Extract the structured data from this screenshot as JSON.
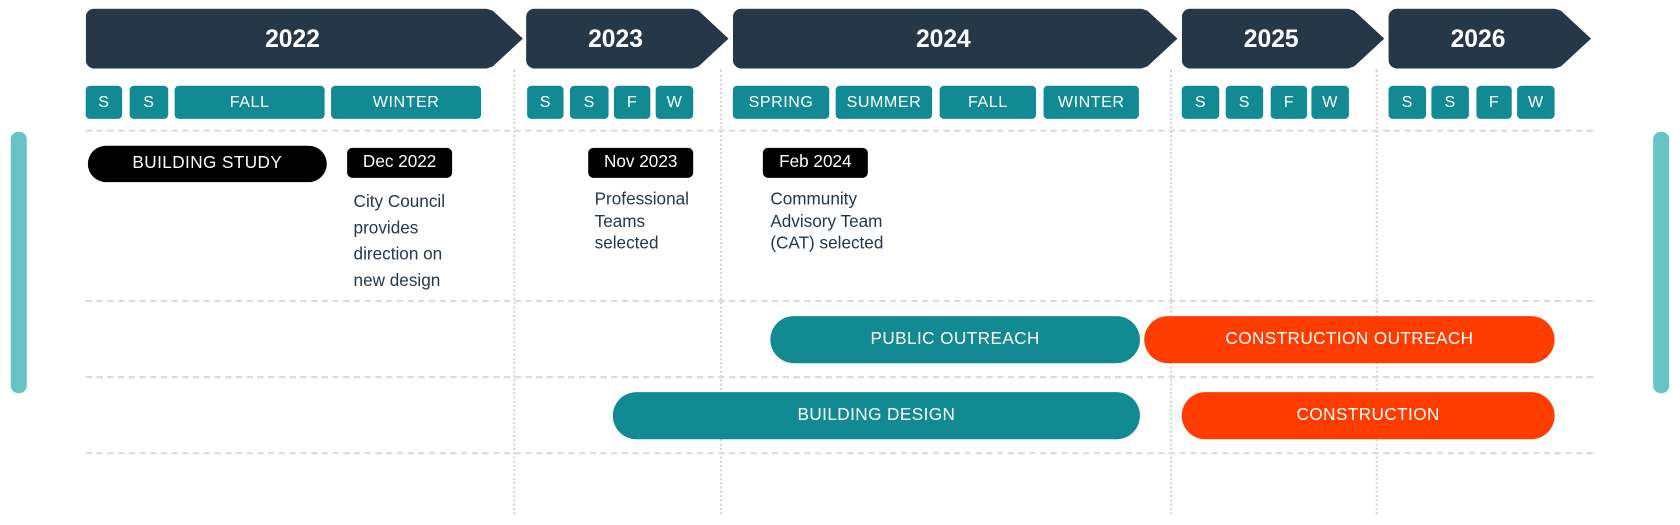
{
  "colors": {
    "year_banner": "#263747",
    "season": "#128a94",
    "phase_teal": "#128a94",
    "phase_orange": "#ff3d00",
    "scroll_bar": "#66c5c4",
    "milestone": "#000000"
  },
  "years": [
    "2022",
    "2023",
    "2024",
    "2025",
    "2026"
  ],
  "seasons": {
    "y2022": [
      "S",
      "S",
      "FALL",
      "WINTER"
    ],
    "y2023": [
      "S",
      "S",
      "F",
      "W"
    ],
    "y2024": [
      "SPRING",
      "SUMMER",
      "FALL",
      "WINTER"
    ],
    "y2025": [
      "S",
      "S",
      "F",
      "W"
    ],
    "y2026": [
      "S",
      "S",
      "F",
      "W"
    ]
  },
  "milestones": {
    "building_study": "BUILDING STUDY",
    "items": [
      {
        "date": "Dec 2022",
        "text": "City Council\nprovides\ndirection on\nnew design"
      },
      {
        "date": "Nov 2023",
        "text": "Professional\nTeams\nselected"
      },
      {
        "date": "Feb 2024",
        "text": "Community\nAdvisory Team\n(CAT) selected"
      }
    ]
  },
  "phases": {
    "public_outreach": "PUBLIC OUTREACH",
    "construction_outreach": "CONSTRUCTION OUTREACH",
    "building_design": "BUILDING DESIGN",
    "construction": "CONSTRUCTION"
  }
}
